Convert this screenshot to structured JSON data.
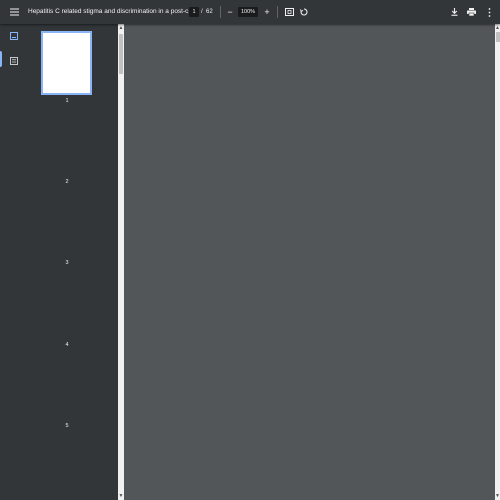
{
  "toolbar": {
    "title": "Hepatitis C related stigma and discrimination in a post-c...",
    "page_current": "1",
    "page_separator": "/",
    "page_total": "62",
    "zoom_minus": "−",
    "zoom_value": "100%",
    "zoom_plus": "+",
    "icons": [
      "menu-icon",
      "fit-page-icon",
      "rotate-icon",
      "download-icon",
      "print-icon",
      "more-vert-icon"
    ]
  },
  "sidebar": {
    "tools": [
      "thumbnails-icon",
      "outline-icon"
    ],
    "pages": [
      "1",
      "2",
      "3",
      "4",
      "5"
    ]
  },
  "colors": {
    "toolbar_bg": "#323639",
    "viewer_bg": "#525659",
    "accent": "#8ab4f8"
  }
}
